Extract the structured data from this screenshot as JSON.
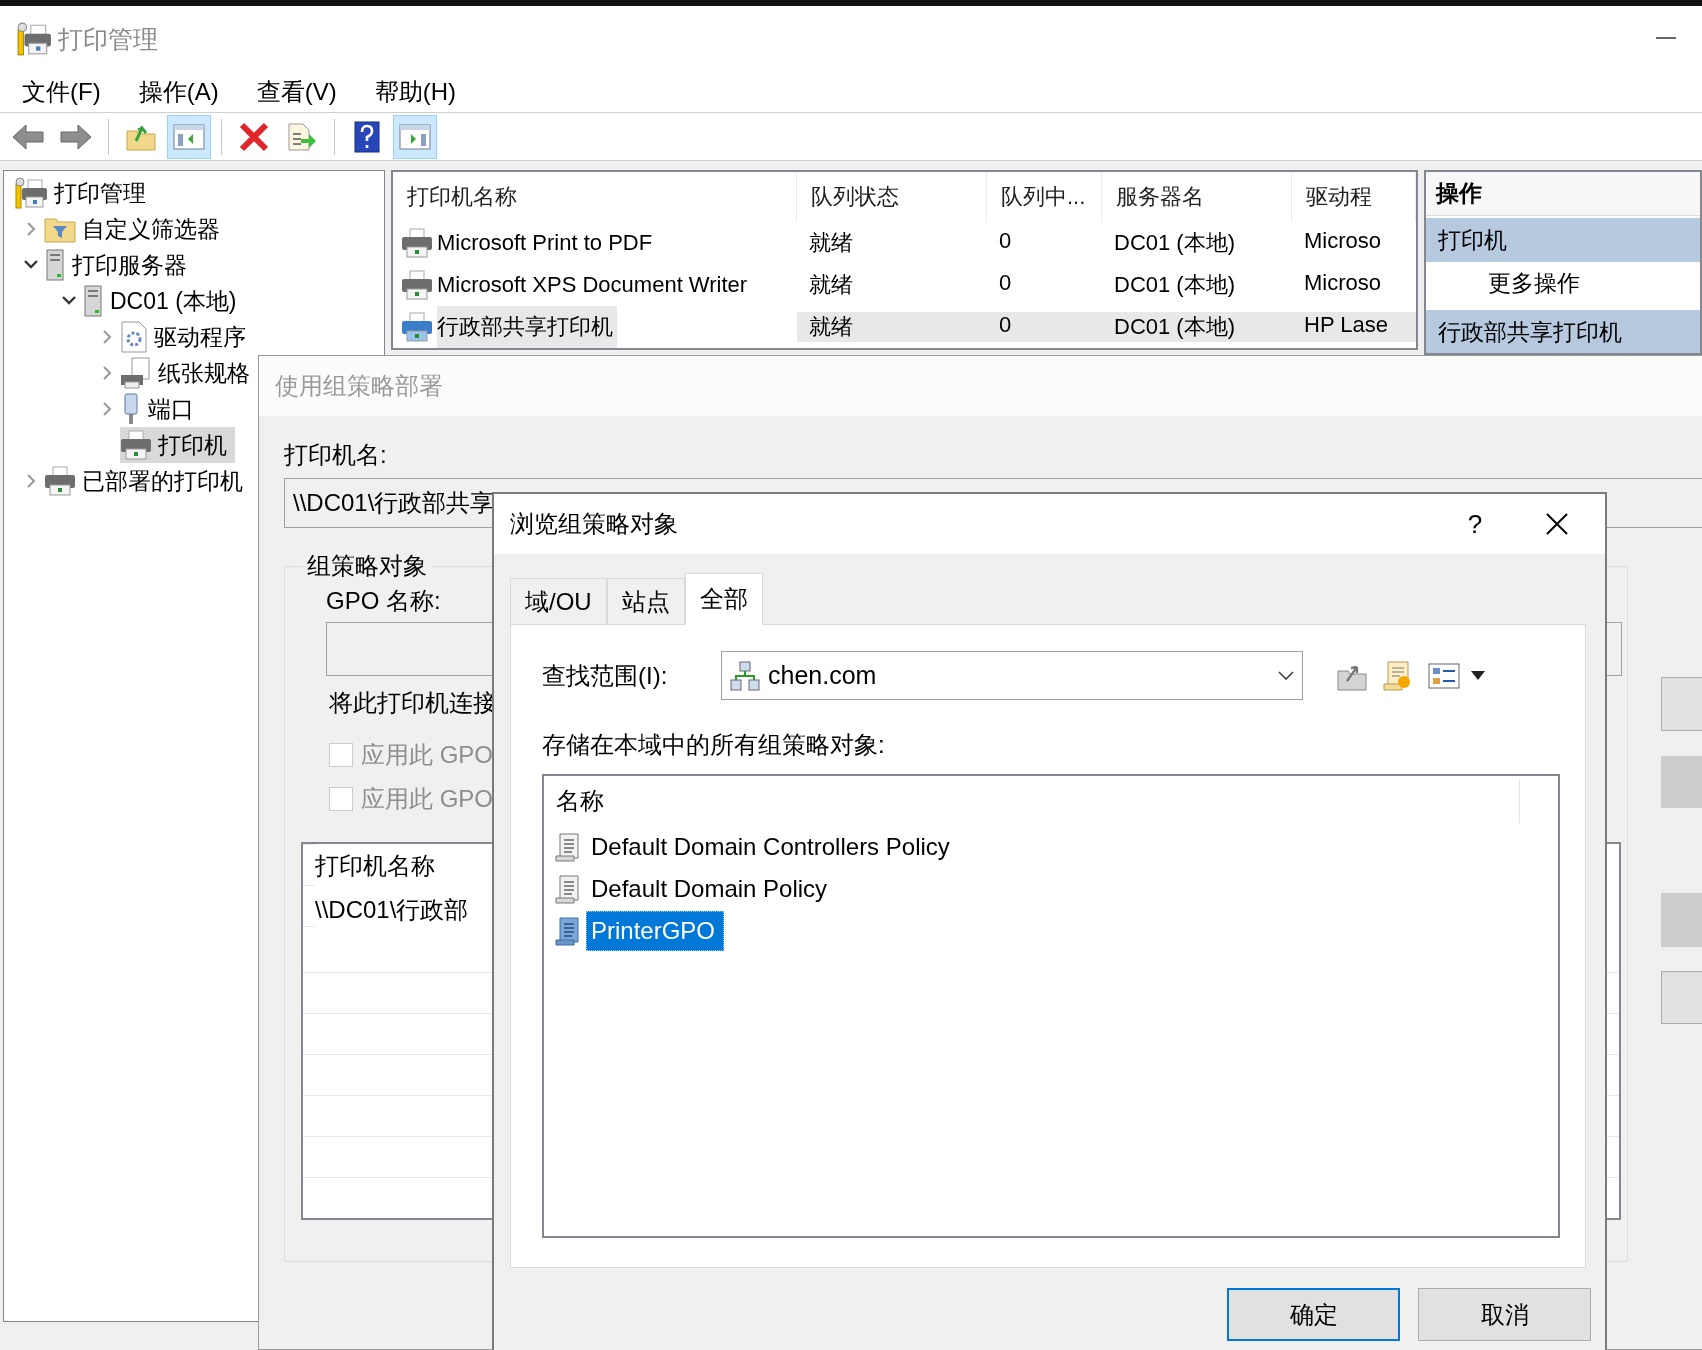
{
  "window": {
    "title": "打印管理"
  },
  "menu": [
    "文件(F)",
    "操作(A)",
    "查看(V)",
    "帮助(H)"
  ],
  "toolbar": [
    {
      "pressed": false
    },
    {
      "pressed": false
    },
    {
      "pressed": false
    },
    {
      "pressed": true
    },
    {
      "pressed": false
    },
    {
      "pressed": false
    },
    {
      "pressed": false
    },
    {
      "pressed": true
    }
  ],
  "tree": [
    {
      "label": "打印管理",
      "kind": "manager",
      "selected": false,
      "children": [
        {
          "label": "自定义筛选器",
          "kind": "filter",
          "expandable": true,
          "expanded": false,
          "selected": false
        },
        {
          "label": "打印服务器",
          "kind": "server",
          "expandable": true,
          "expanded": true,
          "selected": false,
          "children": [
            {
              "label": "DC01 (本地)",
              "kind": "server",
              "expandable": true,
              "expanded": true,
              "selected": false,
              "children": [
                {
                  "label": "驱动程序",
                  "kind": "driver",
                  "expandable": true,
                  "expanded": false,
                  "selected": false
                },
                {
                  "label": "纸张规格",
                  "kind": "paper",
                  "expandable": true,
                  "expanded": false,
                  "selected": false
                },
                {
                  "label": "端口",
                  "kind": "port",
                  "expandable": true,
                  "expanded": false,
                  "selected": false
                },
                {
                  "label": "打印机",
                  "kind": "printer",
                  "expandable": false,
                  "expanded": false,
                  "selected": true
                }
              ]
            }
          ]
        },
        {
          "label": "已部署的打印机",
          "kind": "printer",
          "expandable": true,
          "expanded": false,
          "selected": false
        }
      ]
    }
  ],
  "printer_table": {
    "columns": [
      "打印机名称",
      "队列状态",
      "队列中...",
      "服务器名",
      "驱动程"
    ],
    "rows": [
      {
        "cells": [
          "Microsoft Print to PDF",
          "就绪",
          "0",
          "DC01 (本地)",
          "Microso"
        ],
        "shared": false,
        "selected": false
      },
      {
        "cells": [
          "Microsoft XPS Document Writer",
          "就绪",
          "0",
          "DC01 (本地)",
          "Microso"
        ],
        "shared": false,
        "selected": false
      },
      {
        "cells": [
          "行政部共享打印机",
          "就绪",
          "0",
          "DC01 (本地)",
          "HP Lase"
        ],
        "shared": true,
        "selected": true
      }
    ]
  },
  "actions": {
    "title": "操作",
    "sections": [
      {
        "title": "打印机",
        "items": [
          "更多操作"
        ]
      },
      {
        "title": "行政部共享打印机"
      }
    ]
  },
  "deploy_dialog": {
    "title": "使用组策略部署",
    "printer_label": "打印机名:",
    "printer_value": "\\\\DC01\\行政部共享",
    "group_title": "组策略对象",
    "gpo_label": "GPO 名称:",
    "connect_text": "将此打印机连接",
    "checkboxes": [
      {
        "label": "应用此 GPO",
        "checked": false,
        "disabled": true
      },
      {
        "label": "应用此 GPO",
        "checked": false,
        "disabled": true
      }
    ],
    "list": {
      "header": "打印机名称",
      "rows": [
        "\\\\DC01\\行政部"
      ]
    },
    "side_buttons": [
      {
        "disabled": false
      },
      {
        "disabled": true
      },
      {
        "disabled": true
      },
      {
        "disabled": false
      }
    ]
  },
  "browse_dialog": {
    "title": "浏览组策略对象",
    "help": "?",
    "tabs": [
      {
        "label": "域/OU",
        "selected": false
      },
      {
        "label": "站点",
        "selected": false
      },
      {
        "label": "全部",
        "selected": true
      }
    ],
    "look_in_label": "查找范围(I):",
    "look_in_value": "chen.com",
    "list_label": "存储在本域中的所有组策略对象:",
    "list": {
      "header": "名称",
      "rows": [
        {
          "name": "Default Domain Controllers Policy",
          "selected": false
        },
        {
          "name": "Default Domain Policy",
          "selected": false
        },
        {
          "name": "PrinterGPO",
          "selected": true
        }
      ]
    },
    "buttons": [
      {
        "label": "确定",
        "default": true
      },
      {
        "label": "取消",
        "default": false
      }
    ]
  }
}
